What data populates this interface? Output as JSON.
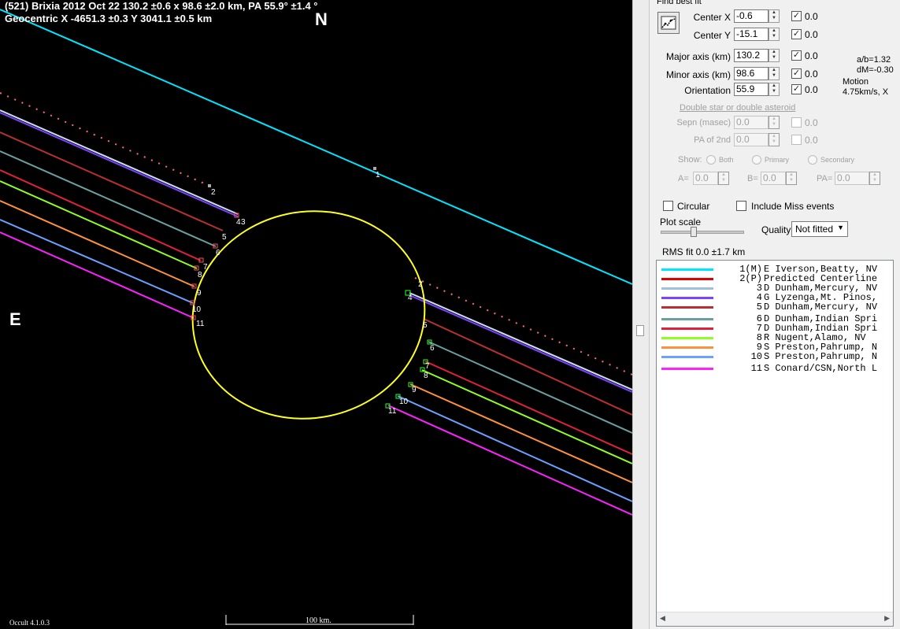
{
  "plot": {
    "header_line1": "(521) Brixia  2012 Oct 22   130.2 ±0.6 x 98.6 ±2.0 km,  PA 55.9° ±1.4 °",
    "header_line2": "Geocentric  X  -4651.3 ±0.3  Y 3041.1 ±0.5 km",
    "north": "N",
    "east": "E",
    "scale_label": "100 km.",
    "version": "Occult 4.1.0.3",
    "chord_numbers": [
      "1",
      "2",
      "3",
      "4",
      "5",
      "6",
      "7",
      "8",
      "9",
      "10",
      "11"
    ]
  },
  "panel": {
    "find_best_fit": "Find best fit",
    "center_x_label": "Center X",
    "center_x_value": "-0.6",
    "center_x_unc": "0.0",
    "center_y_label": "Center Y",
    "center_y_value": "-15.1",
    "center_y_unc": "0.0",
    "major_label": "Major axis (km)",
    "major_value": "130.2",
    "major_unc": "0.0",
    "minor_label": "Minor axis (km)",
    "minor_value": "98.6",
    "minor_unc": "0.0",
    "orient_label": "Orientation",
    "orient_value": "55.9",
    "orient_unc": "0.0",
    "ab_ratio": "a/b=1.32",
    "dm": "dM=-0.30",
    "motion_label": "Motion",
    "motion_value": "4.75km/s, X",
    "double_star_link": "Double star  or  double asteroid",
    "sepn_label": "Sepn (masec)",
    "sepn_value": "0.0",
    "sepn_unc": "0.0",
    "pa2_label": "PA of 2nd",
    "pa2_value": "0.0",
    "pa2_unc": "0.0",
    "show_label": "Show:",
    "show_both": "Both",
    "show_primary": "Primary",
    "show_secondary": "Secondary",
    "a_label": "A=",
    "a_value": "0.0",
    "b_label": "B=",
    "b_value": "0.0",
    "pa_label": "PA=",
    "pa_value": "0.0",
    "circular_label": "Circular",
    "miss_label": "Include Miss events",
    "plot_scale_label": "Plot scale",
    "quality_label": "Quality",
    "quality_value": "Not fitted",
    "rms_fit": "RMS fit 0.0 ±1.7 km"
  },
  "legend": [
    {
      "num": "1(M)",
      "name": "E Iverson,Beatty, NV",
      "color": "#00e6ff"
    },
    {
      "num": "2(P)",
      "name": "Predicted Centerline",
      "color": "#e00000"
    },
    {
      "num": "3",
      "name": "D Dunham,Mercury, NV",
      "color": "#9ec0d8"
    },
    {
      "num": "4",
      "name": "G Lyzenga,Mt. Pinos,",
      "color": "#8040ff"
    },
    {
      "num": "5",
      "name": "D Dunham,Mercury, NV",
      "color": "#b83030"
    },
    {
      "num": "6",
      "name": "D Dunham,Indian Spri",
      "color": "#6aa0a0"
    },
    {
      "num": "7",
      "name": "D Dunham,Indian Spri",
      "color": "#e0203c"
    },
    {
      "num": "8",
      "name": "R Nugent,Alamo, NV",
      "color": "#90ff20"
    },
    {
      "num": "9",
      "name": "S Preston,Pahrump, N",
      "color": "#ff9040"
    },
    {
      "num": "10",
      "name": "S Preston,Pahrump, N",
      "color": "#6aa0ff"
    },
    {
      "num": "11",
      "name": "S Conard/CSN,North L",
      "color": "#ff20ff"
    }
  ]
}
